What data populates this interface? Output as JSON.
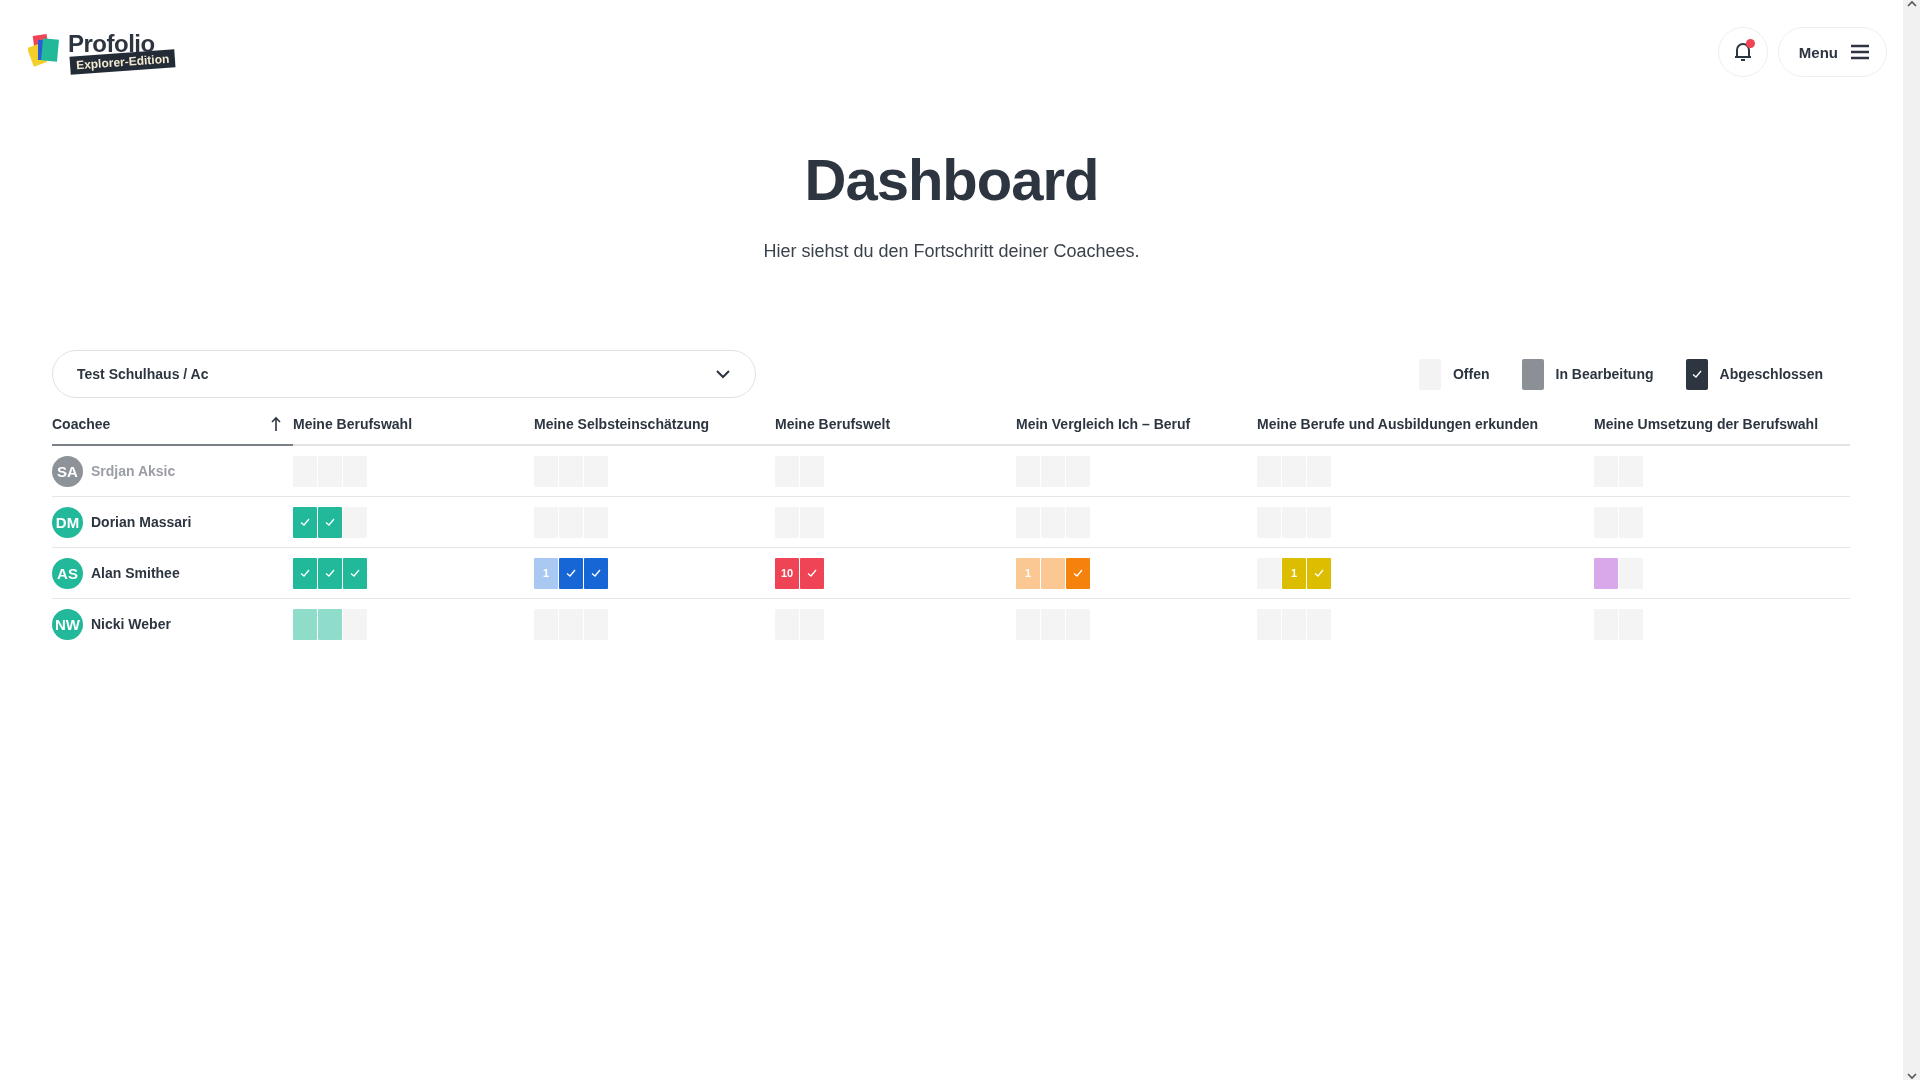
{
  "header": {
    "logo_name": "Profolio",
    "logo_badge": "Explorer-Edition",
    "notification_unread": true,
    "menu_label": "Menu"
  },
  "title": "Dashboard",
  "subtitle": "Hier siehst du den Fortschritt deiner Coachees.",
  "class_select": {
    "value": "Test Schulhaus / Ac"
  },
  "legend": [
    {
      "label": "Offen",
      "kind": "open"
    },
    {
      "label": "In Bearbeitung",
      "kind": "progress"
    },
    {
      "label": "Abgeschlossen",
      "kind": "done"
    }
  ],
  "table": {
    "coachee_header": "Coachee",
    "sort_ascending": true,
    "columns": [
      {
        "label": "Meine Berufswahl",
        "color": "#22b89a"
      },
      {
        "label": "Meine Selbsteinschätzung",
        "color": "#1766d6"
      },
      {
        "label": "Meine Berufswelt",
        "color": "#ee4455"
      },
      {
        "label": "Mein Vergleich Ich – Beruf",
        "color": "#f5820d"
      },
      {
        "label": "Meine Berufe und Ausbildungen erkunden",
        "color": "#dcbd00"
      },
      {
        "label": "Meine Umsetzung der Berufswahl"
      }
    ],
    "rows": [
      {
        "initials": "SA",
        "name": "Srdjan Aksic",
        "disabled": true,
        "cells": [
          [
            {
              "kind": "open"
            },
            {
              "kind": "open"
            },
            {
              "kind": "open"
            }
          ],
          [
            {
              "kind": "open"
            },
            {
              "kind": "open"
            },
            {
              "kind": "open"
            }
          ],
          [
            {
              "kind": "open"
            },
            {
              "kind": "open"
            }
          ],
          [
            {
              "kind": "open"
            },
            {
              "kind": "open"
            },
            {
              "kind": "open"
            }
          ],
          [
            {
              "kind": "open"
            },
            {
              "kind": "open"
            },
            {
              "kind": "open"
            }
          ],
          [
            {
              "kind": "open"
            },
            {
              "kind": "open"
            }
          ]
        ]
      },
      {
        "initials": "DM",
        "name": "Dorian Massari",
        "disabled": false,
        "cells": [
          [
            {
              "kind": "done"
            },
            {
              "kind": "done"
            },
            {
              "kind": "open"
            }
          ],
          [
            {
              "kind": "open"
            },
            {
              "kind": "open"
            },
            {
              "kind": "open"
            }
          ],
          [
            {
              "kind": "open"
            },
            {
              "kind": "open"
            }
          ],
          [
            {
              "kind": "open"
            },
            {
              "kind": "open"
            },
            {
              "kind": "open"
            }
          ],
          [
            {
              "kind": "open"
            },
            {
              "kind": "open"
            },
            {
              "kind": "open"
            }
          ],
          [
            {
              "kind": "open"
            },
            {
              "kind": "open"
            }
          ]
        ]
      },
      {
        "initials": "AS",
        "name": "Alan Smithee",
        "disabled": false,
        "cells": [
          [
            {
              "kind": "done"
            },
            {
              "kind": "done"
            },
            {
              "kind": "done"
            }
          ],
          [
            {
              "kind": "progress",
              "label": "1",
              "color": "#a9c8f2"
            },
            {
              "kind": "done"
            },
            {
              "kind": "done"
            }
          ],
          [
            {
              "kind": "done",
              "label": "10"
            },
            {
              "kind": "done"
            }
          ],
          [
            {
              "kind": "progress",
              "label": "1",
              "color": "#fbc792"
            },
            {
              "kind": "progress",
              "color": "#fbc792"
            },
            {
              "kind": "done"
            }
          ],
          [
            {
              "kind": "open"
            },
            {
              "kind": "done",
              "label": "1"
            },
            {
              "kind": "done"
            }
          ],
          [
            {
              "kind": "progress",
              "color": "#d8a8ea"
            },
            {
              "kind": "open"
            }
          ]
        ]
      },
      {
        "initials": "NW",
        "name": "Nicki Weber",
        "disabled": false,
        "cells": [
          [
            {
              "kind": "progress",
              "color": "#8fdcca"
            },
            {
              "kind": "progress",
              "color": "#8fdcca"
            },
            {
              "kind": "open"
            }
          ],
          [
            {
              "kind": "open"
            },
            {
              "kind": "open"
            },
            {
              "kind": "open"
            }
          ],
          [
            {
              "kind": "open"
            },
            {
              "kind": "open"
            }
          ],
          [
            {
              "kind": "open"
            },
            {
              "kind": "open"
            },
            {
              "kind": "open"
            }
          ],
          [
            {
              "kind": "open"
            },
            {
              "kind": "open"
            },
            {
              "kind": "open"
            }
          ],
          [
            {
              "kind": "open"
            },
            {
              "kind": "open"
            }
          ]
        ]
      }
    ]
  }
}
